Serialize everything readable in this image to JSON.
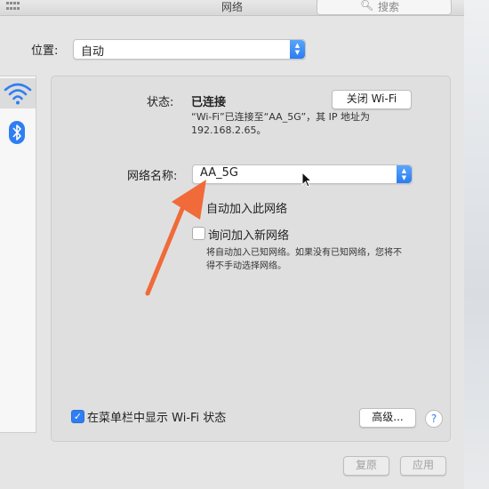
{
  "window": {
    "title": "网络",
    "search_placeholder": "搜索"
  },
  "location": {
    "label": "位置:",
    "value": "自动"
  },
  "sidebar": {
    "items": [
      {
        "icon": "wifi-icon",
        "selected": true
      },
      {
        "icon": "bluetooth-icon",
        "selected": false
      }
    ]
  },
  "status": {
    "label": "状态:",
    "value": "已连接",
    "description_line1": "“Wi-Fi”已连接至“AA_5G”，其 IP 地址为",
    "description_line2": "192.168.2.65。",
    "toggle_wifi_button": "关闭 Wi-Fi"
  },
  "network_name": {
    "label": "网络名称:",
    "value": "AA_5G"
  },
  "options": {
    "auto_join_label": "自动加入此网络",
    "ask_new_label": "询问加入新网络",
    "ask_new_checked": false,
    "help_line1": "将自动加入已知网络。如果没有已知网络，您将不",
    "help_line2": "得不手动选择网络。"
  },
  "footer": {
    "show_in_menubar_label": "在菜单栏中显示 Wi-Fi 状态",
    "show_in_menubar_checked": true,
    "advanced_button": "高级...",
    "help_button": "?",
    "revert_button": "复原",
    "apply_button": "应用"
  },
  "colors": {
    "accent": "#2f7ef2",
    "annotation_arrow": "#f06a3a"
  }
}
